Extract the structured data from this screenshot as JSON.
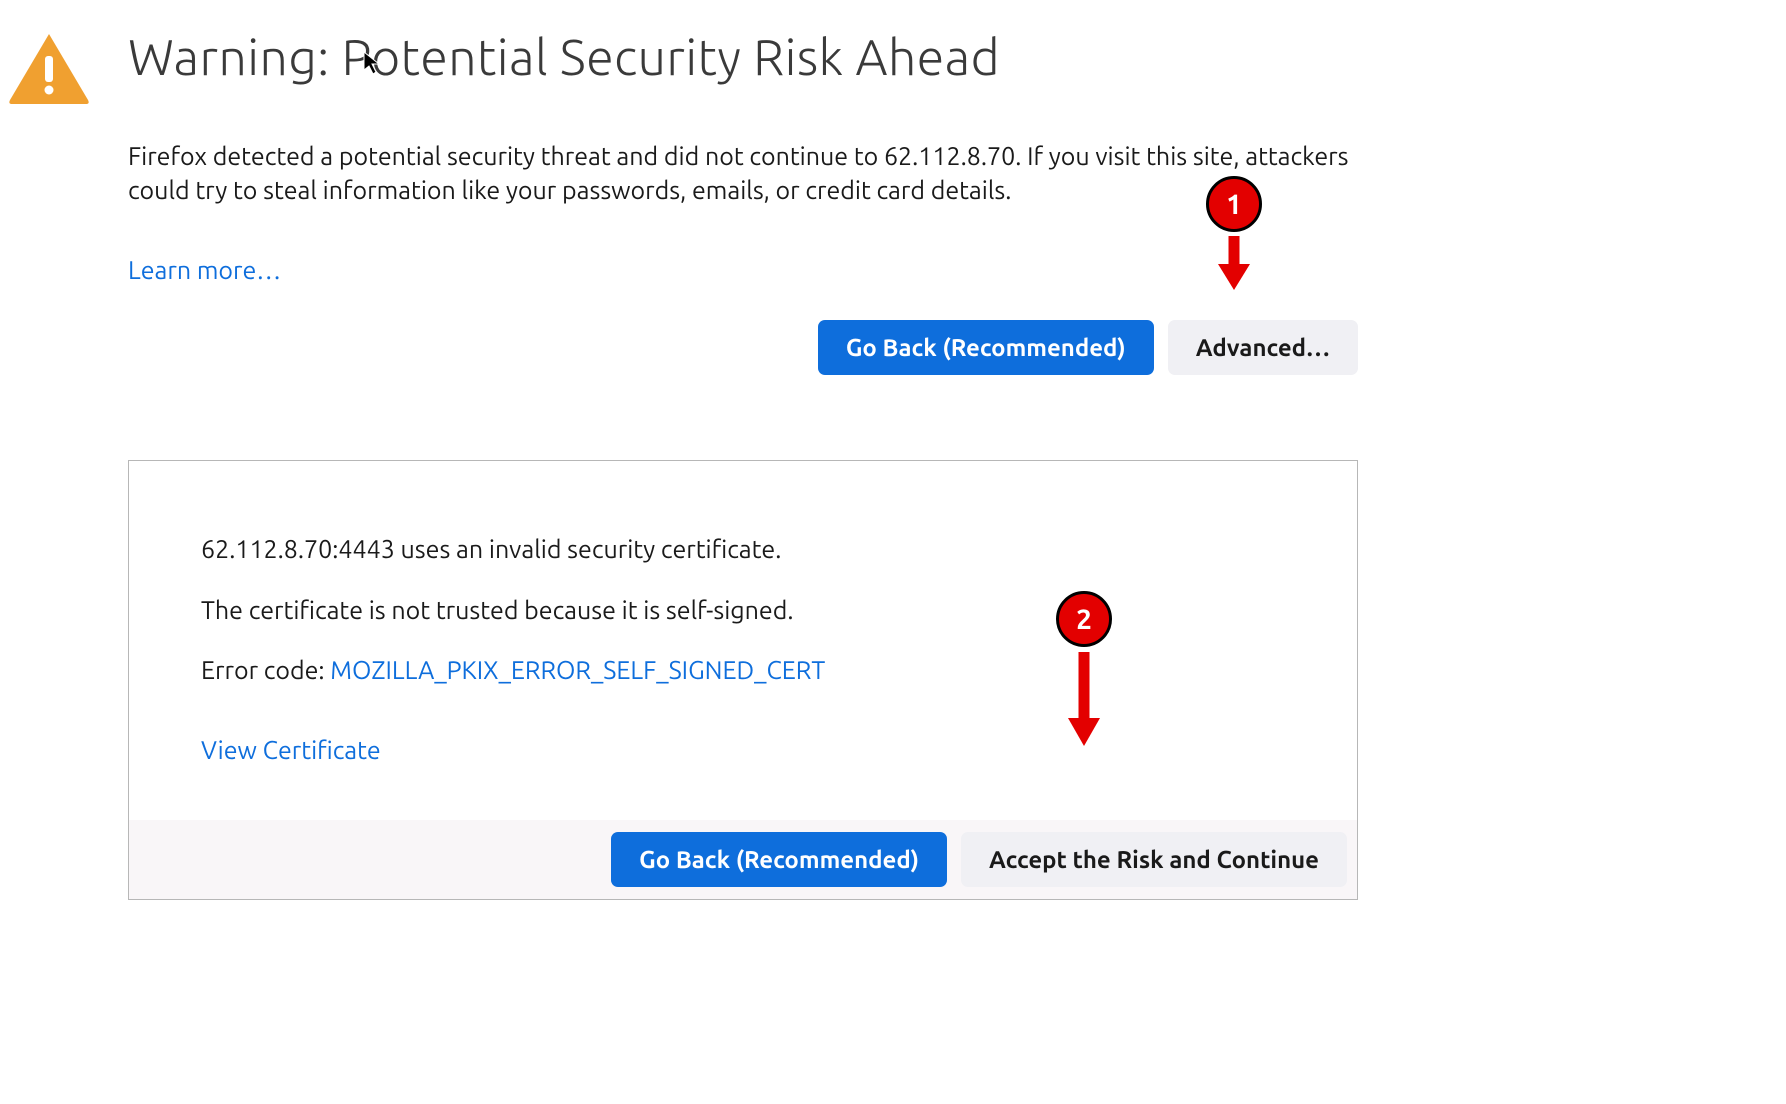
{
  "header": {
    "title": "Warning: Potential Security Risk Ahead"
  },
  "main": {
    "description": "Firefox detected a potential security threat and did not continue to 62.112.8.70. If you visit this site, attackers could try to steal information like your passwords, emails, or credit card details.",
    "learn_more": "Learn more…",
    "go_back": "Go Back (Recommended)",
    "advanced": "Advanced…"
  },
  "advanced_panel": {
    "line1": "62.112.8.70:4443 uses an invalid security certificate.",
    "line2": "The certificate is not trusted because it is self-signed.",
    "error_label": "Error code: ",
    "error_code": "MOZILLA_PKIX_ERROR_SELF_SIGNED_CERT",
    "view_cert": "View Certificate",
    "go_back": "Go Back (Recommended)",
    "accept": "Accept the Risk and Continue"
  },
  "annotations": {
    "callout1": "1",
    "callout2": "2"
  }
}
